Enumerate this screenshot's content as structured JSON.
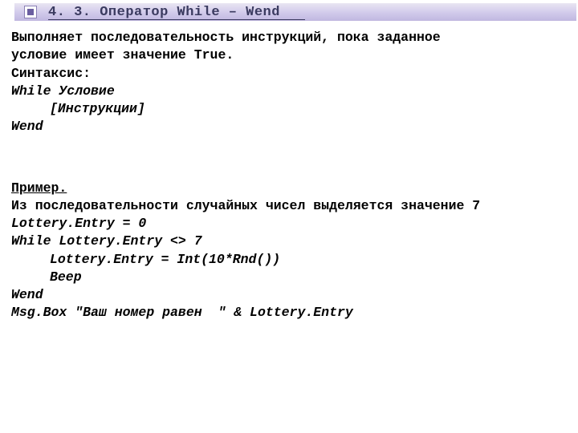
{
  "title": "4. 3. Оператор While – Wend",
  "intro": {
    "line1": "Выполняет последовательность инструкций, пока заданное",
    "line2": "условие имеет значение True.",
    "line3": "Синтаксис:"
  },
  "syntax": {
    "line1": "While Условие",
    "line2": "[Инструкции]",
    "line3": "Wend"
  },
  "example": {
    "heading": "Пример.",
    "desc": "Из последовательности случайных чисел выделяется значение 7",
    "code1": "Lottery.Entry = 0",
    "code2": "While Lottery.Entry <> 7",
    "code3": "Lottery.Entry = Int(10*Rnd())",
    "code4": "Beep",
    "code5": "Wend",
    "code6": "Msg.Box \"Ваш номер равен  \" & Lottery.Entry"
  }
}
